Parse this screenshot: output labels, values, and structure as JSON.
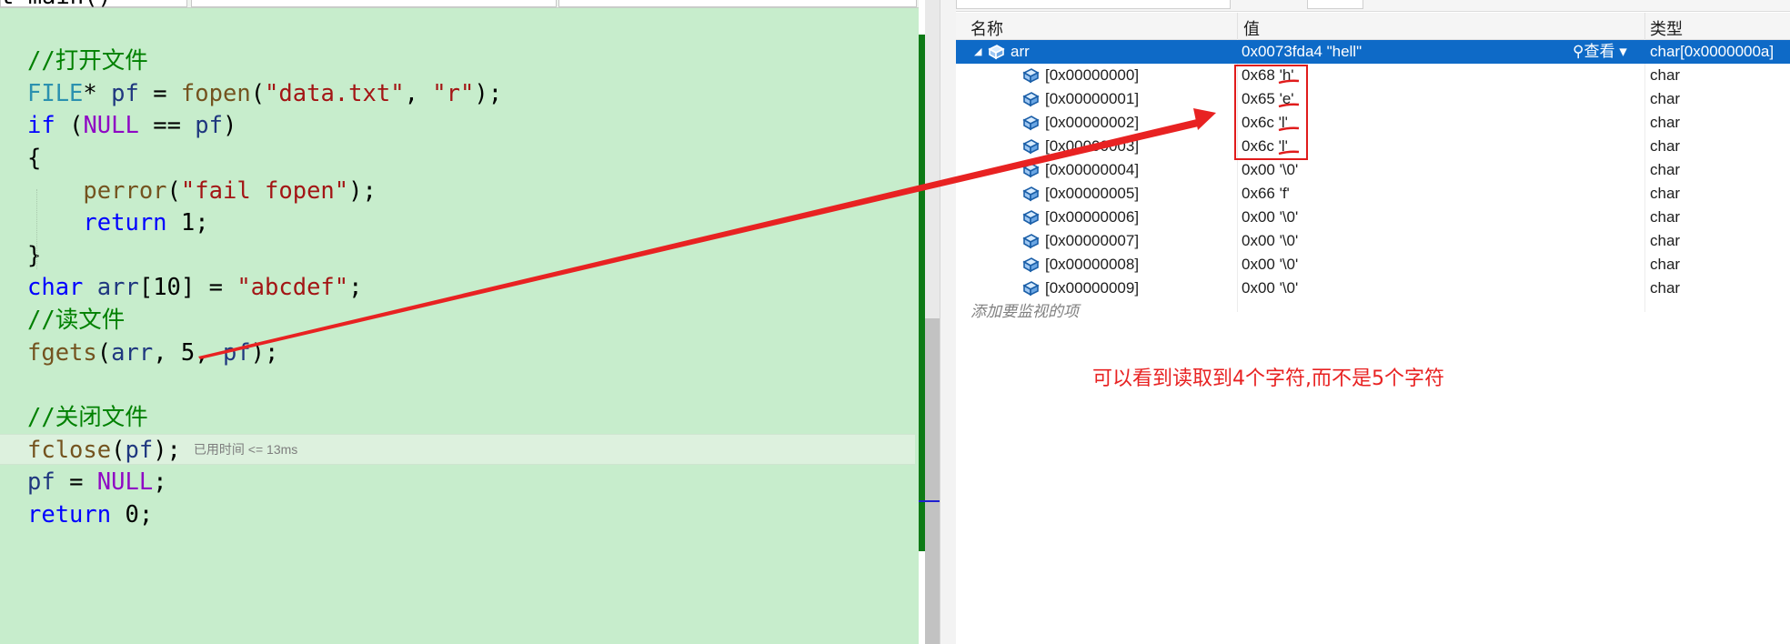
{
  "editor": {
    "lines": [
      {
        "tokens": [
          {
            "t": "t main()",
            "c": "pl"
          }
        ]
      },
      {
        "tokens": []
      },
      {
        "tokens": [
          {
            "t": "//打开文件",
            "c": "cm"
          }
        ]
      },
      {
        "tokens": [
          {
            "t": "FILE",
            "c": "ty"
          },
          {
            "t": "* ",
            "c": "pl"
          },
          {
            "t": "pf",
            "c": "va"
          },
          {
            "t": " = ",
            "c": "pl"
          },
          {
            "t": "fopen",
            "c": "fn"
          },
          {
            "t": "(",
            "c": "pl"
          },
          {
            "t": "\"data.txt\"",
            "c": "st"
          },
          {
            "t": ", ",
            "c": "pl"
          },
          {
            "t": "\"r\"",
            "c": "st"
          },
          {
            "t": ");",
            "c": "pl"
          }
        ]
      },
      {
        "tokens": [
          {
            "t": "if",
            "c": "kw"
          },
          {
            "t": " (",
            "c": "pl"
          },
          {
            "t": "NULL",
            "c": "mc"
          },
          {
            "t": " == ",
            "c": "pl"
          },
          {
            "t": "pf",
            "c": "va"
          },
          {
            "t": ")",
            "c": "pl"
          }
        ]
      },
      {
        "tokens": [
          {
            "t": "{",
            "c": "pl"
          }
        ]
      },
      {
        "tokens": [
          {
            "t": "    ",
            "c": "pl"
          },
          {
            "t": "perror",
            "c": "fn"
          },
          {
            "t": "(",
            "c": "pl"
          },
          {
            "t": "\"fail fopen\"",
            "c": "st"
          },
          {
            "t": ");",
            "c": "pl"
          }
        ]
      },
      {
        "tokens": [
          {
            "t": "    ",
            "c": "pl"
          },
          {
            "t": "return",
            "c": "kw"
          },
          {
            "t": " 1;",
            "c": "pl"
          }
        ]
      },
      {
        "tokens": [
          {
            "t": "}",
            "c": "pl"
          }
        ]
      },
      {
        "tokens": [
          {
            "t": "char",
            "c": "kw"
          },
          {
            "t": " ",
            "c": "pl"
          },
          {
            "t": "arr",
            "c": "va"
          },
          {
            "t": "[10] = ",
            "c": "pl"
          },
          {
            "t": "\"abcdef\"",
            "c": "st"
          },
          {
            "t": ";",
            "c": "pl"
          }
        ]
      },
      {
        "tokens": [
          {
            "t": "//读文件",
            "c": "cm"
          }
        ]
      },
      {
        "tokens": [
          {
            "t": "fgets",
            "c": "fn"
          },
          {
            "t": "(",
            "c": "pl"
          },
          {
            "t": "arr",
            "c": "va"
          },
          {
            "t": ", 5, ",
            "c": "pl"
          },
          {
            "t": "pf",
            "c": "va"
          },
          {
            "t": ");",
            "c": "pl"
          }
        ]
      },
      {
        "tokens": []
      },
      {
        "tokens": [
          {
            "t": "//关闭文件",
            "c": "cm"
          }
        ]
      },
      {
        "tokens": [
          {
            "t": "fclose",
            "c": "fn"
          },
          {
            "t": "(",
            "c": "pl"
          },
          {
            "t": "pf",
            "c": "va"
          },
          {
            "t": ");",
            "c": "pl"
          }
        ],
        "current": true,
        "hint": "已用时间 <= 13ms"
      },
      {
        "tokens": [
          {
            "t": "pf",
            "c": "va"
          },
          {
            "t": " = ",
            "c": "pl"
          },
          {
            "t": "NULL",
            "c": "mc"
          },
          {
            "t": ";",
            "c": "pl"
          }
        ]
      },
      {
        "tokens": [
          {
            "t": "return",
            "c": "kw"
          },
          {
            "t": " 0;",
            "c": "pl"
          }
        ]
      }
    ]
  },
  "watch": {
    "headers": {
      "name": "名称",
      "value": "值",
      "type": "类型"
    },
    "rows": [
      {
        "name": "arr",
        "value": "0x0073fda4 \"hell\"",
        "type": "char[0x0000000a]",
        "selected": true,
        "expanded": true,
        "view_label": "查看"
      },
      {
        "name": "[0x00000000]",
        "value": "0x68 'h'",
        "type": "char"
      },
      {
        "name": "[0x00000001]",
        "value": "0x65 'e'",
        "type": "char"
      },
      {
        "name": "[0x00000002]",
        "value": "0x6c 'l'",
        "type": "char"
      },
      {
        "name": "[0x00000003]",
        "value": "0x6c 'l'",
        "type": "char"
      },
      {
        "name": "[0x00000004]",
        "value": "0x00 '\\0'",
        "type": "char"
      },
      {
        "name": "[0x00000005]",
        "value": "0x66 'f'",
        "type": "char"
      },
      {
        "name": "[0x00000006]",
        "value": "0x00 '\\0'",
        "type": "char"
      },
      {
        "name": "[0x00000007]",
        "value": "0x00 '\\0'",
        "type": "char"
      },
      {
        "name": "[0x00000008]",
        "value": "0x00 '\\0'",
        "type": "char"
      },
      {
        "name": "[0x00000009]",
        "value": "0x00 '\\0'",
        "type": "char"
      }
    ],
    "add_placeholder": "添加要监视的项"
  },
  "annotation": {
    "text": "可以看到读取到4个字符,而不是5个字符",
    "color": "#e82222"
  },
  "icons": {
    "element": "variable-field-icon",
    "search": "search-icon",
    "dropdown": "chevron-down-icon",
    "expander": "collapse-triangle-icon"
  }
}
